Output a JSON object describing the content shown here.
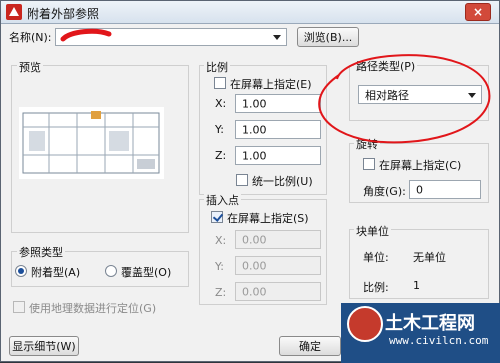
{
  "window": {
    "title": "附着外部参照",
    "close_label": "×"
  },
  "name_row": {
    "label": "名称(N):",
    "browse_button": "浏览(B)..."
  },
  "preview": {
    "label": "预览"
  },
  "scale": {
    "label": "比例",
    "specify_on_screen": "在屏幕上指定(E)",
    "x_label": "X:",
    "x_value": "1.00",
    "y_label": "Y:",
    "y_value": "1.00",
    "z_label": "Z:",
    "z_value": "1.00",
    "uniform_scale": "统一比例(U)"
  },
  "insertion": {
    "label": "插入点",
    "specify_on_screen": "在屏幕上指定(S)",
    "x_label": "X:",
    "x_value": "0.00",
    "y_label": "Y:",
    "y_value": "0.00",
    "z_label": "Z:",
    "z_value": "0.00"
  },
  "path_type": {
    "label": "路径类型(P)",
    "value": "相对路径"
  },
  "rotation": {
    "label": "旋转",
    "specify_on_screen": "在屏幕上指定(C)",
    "angle_label": "角度(G):",
    "angle_value": "0"
  },
  "block_unit": {
    "label": "块单位",
    "unit_label": "单位:",
    "unit_value": "无单位",
    "factor_label": "比例:",
    "factor_value": "1"
  },
  "reference_type": {
    "label": "参照类型",
    "attach": "附着型(A)",
    "overlay": "覆盖型(O)"
  },
  "geo": {
    "label": "使用地理数据进行定位(G)"
  },
  "buttons": {
    "details": "显示细节(W)",
    "ok": "确定"
  },
  "watermark": {
    "title": "土木工程网",
    "url": "www.civilcn.com"
  }
}
